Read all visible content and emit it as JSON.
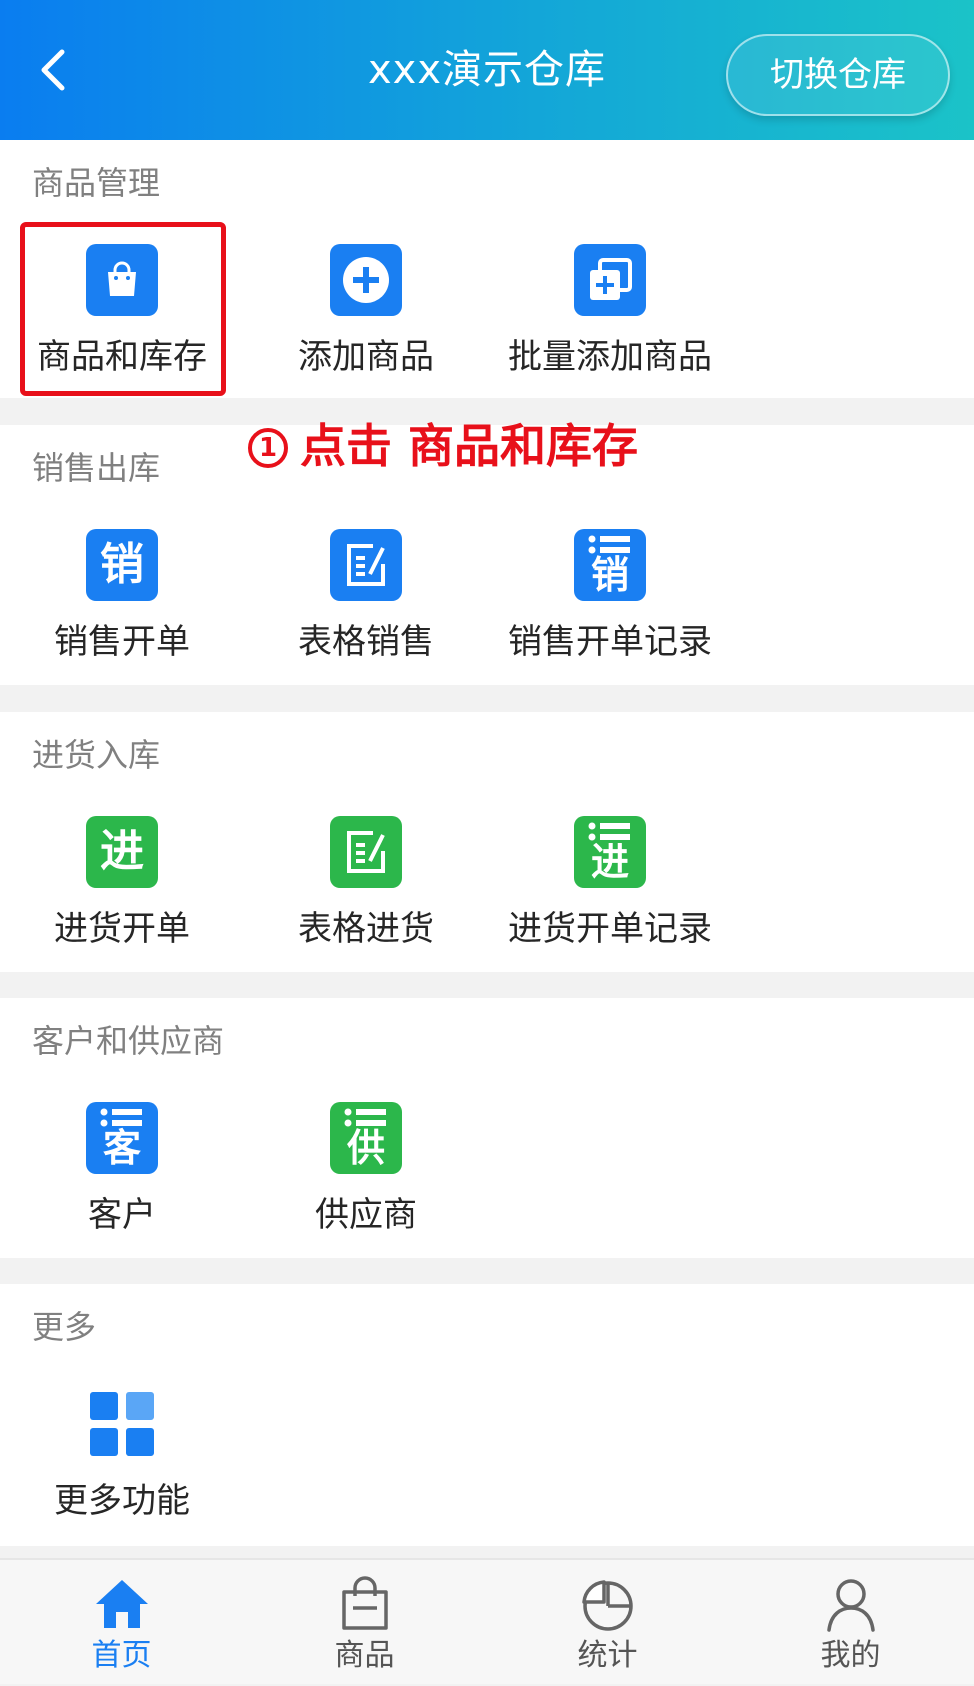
{
  "header": {
    "title": "xxx演示仓库",
    "switch_label": "切换仓库"
  },
  "sections": [
    {
      "title": "商品管理",
      "items": [
        {
          "label": "商品和库存",
          "icon": "shopping-bag-icon"
        },
        {
          "label": "添加商品",
          "icon": "plus-circle-icon"
        },
        {
          "label": "批量添加商品",
          "icon": "batch-add-icon"
        }
      ]
    },
    {
      "title": "销售出库",
      "items": [
        {
          "label": "销售开单",
          "icon": "sale-char-icon",
          "glyph": "销"
        },
        {
          "label": "表格销售",
          "icon": "edit-form-icon"
        },
        {
          "label": "销售开单记录",
          "icon": "sale-records-icon",
          "glyph": "销"
        }
      ]
    },
    {
      "title": "进货入库",
      "items": [
        {
          "label": "进货开单",
          "icon": "purchase-char-icon",
          "glyph": "进"
        },
        {
          "label": "表格进货",
          "icon": "edit-form-icon"
        },
        {
          "label": "进货开单记录",
          "icon": "purchase-records-icon",
          "glyph": "进"
        }
      ]
    },
    {
      "title": "客户和供应商",
      "items": [
        {
          "label": "客户",
          "icon": "customer-list-icon",
          "glyph": "客"
        },
        {
          "label": "供应商",
          "icon": "supplier-list-icon",
          "glyph": "供"
        }
      ]
    },
    {
      "title": "更多",
      "items": [
        {
          "label": "更多功能",
          "icon": "grid-icon"
        }
      ]
    }
  ],
  "annotation": {
    "number": "1",
    "text": "点击 商品和库存"
  },
  "tabbar": [
    {
      "label": "首页",
      "icon": "home-icon",
      "active": true
    },
    {
      "label": "商品",
      "icon": "bag-icon",
      "active": false
    },
    {
      "label": "统计",
      "icon": "pie-chart-icon",
      "active": false
    },
    {
      "label": "我的",
      "icon": "user-icon",
      "active": false
    }
  ],
  "colors": {
    "primary_blue": "#1a7ff2",
    "green": "#2cb74b",
    "highlight_red": "#e8101a",
    "header_start": "#0a7df0",
    "header_end": "#1bc3c8"
  }
}
